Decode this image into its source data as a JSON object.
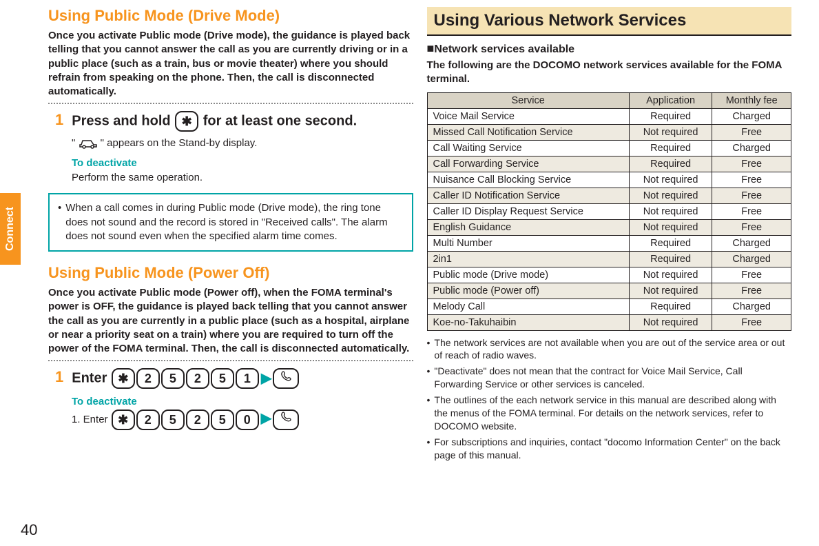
{
  "sidebar": {
    "label": "Connect"
  },
  "page_number": "40",
  "left": {
    "section1": {
      "title": "Using Public Mode (Drive Mode)",
      "intro": "Once you activate Public mode (Drive mode), the guidance is played back telling that you cannot answer the call as you are currently driving or in a public place (such as a train, bus or movie theater) where you should refrain from speaking on the phone. Then, the call is disconnected automatically.",
      "step_num": "1",
      "step_text_a": "Press and hold ",
      "step_key": "✱",
      "step_text_b": " for at least one second.",
      "sub_quote_a": "\"",
      "sub_quote_b": "\" appears on the Stand-by display.",
      "deact_title": "To deactivate",
      "deact_text": "Perform the same operation.",
      "note": "When a call comes in during Public mode (Drive mode), the ring tone does not sound and the record is stored in \"Received calls\". The alarm does not sound even when the specified alarm time comes."
    },
    "section2": {
      "title": "Using Public Mode (Power Off)",
      "intro": "Once you activate Public mode (Power off), when the FOMA terminal's power is OFF, the guidance is played back telling that you cannot answer the call as you are currently in a public place (such as a hospital, airplane or near a priority seat on a train) where you are required to turn off the power of the FOMA terminal. Then, the call is disconnected automatically.",
      "step_num": "1",
      "step_label": "Enter",
      "keys": [
        "✱",
        "2",
        "5",
        "2",
        "5",
        "1"
      ],
      "deact_title": "To deactivate",
      "deact_step": "1. Enter",
      "deact_keys": [
        "✱",
        "2",
        "5",
        "2",
        "5",
        "0"
      ]
    }
  },
  "right": {
    "banner": "Using Various Network Services",
    "sub_heading": "Network services available",
    "desc": "The following are the DOCOMO network services available for the FOMA terminal.",
    "table": {
      "headers": [
        "Service",
        "Application",
        "Monthly fee"
      ],
      "rows": [
        {
          "s": "Voice Mail Service",
          "a": "Required",
          "f": "Charged"
        },
        {
          "s": "Missed Call Notification Service",
          "a": "Not required",
          "f": "Free"
        },
        {
          "s": "Call Waiting Service",
          "a": "Required",
          "f": "Charged"
        },
        {
          "s": "Call Forwarding Service",
          "a": "Required",
          "f": "Free"
        },
        {
          "s": "Nuisance Call Blocking Service",
          "a": "Not required",
          "f": "Free"
        },
        {
          "s": "Caller ID Notification Service",
          "a": "Not required",
          "f": "Free"
        },
        {
          "s": "Caller ID Display Request Service",
          "a": "Not required",
          "f": "Free"
        },
        {
          "s": "English Guidance",
          "a": "Not required",
          "f": "Free"
        },
        {
          "s": "Multi Number",
          "a": "Required",
          "f": "Charged"
        },
        {
          "s": "2in1",
          "a": "Required",
          "f": "Charged"
        },
        {
          "s": "Public mode (Drive mode)",
          "a": "Not required",
          "f": "Free"
        },
        {
          "s": "Public mode (Power off)",
          "a": "Not required",
          "f": "Free"
        },
        {
          "s": "Melody Call",
          "a": "Required",
          "f": "Charged"
        },
        {
          "s": "Koe-no-Takuhaibin",
          "a": "Not required",
          "f": "Free"
        }
      ]
    },
    "footnotes": [
      "The network services are not available when you are out of the service area or out of reach of radio waves.",
      "\"Deactivate\" does not mean that the contract for Voice Mail Service, Call Forwarding Service or other services is canceled.",
      "The outlines of the each network service in this manual are described along with the menus of the FOMA terminal. For details on the network services, refer to DOCOMO website.",
      "For subscriptions and inquiries, contact \"docomo Information Center\" on the back page of this manual."
    ]
  }
}
